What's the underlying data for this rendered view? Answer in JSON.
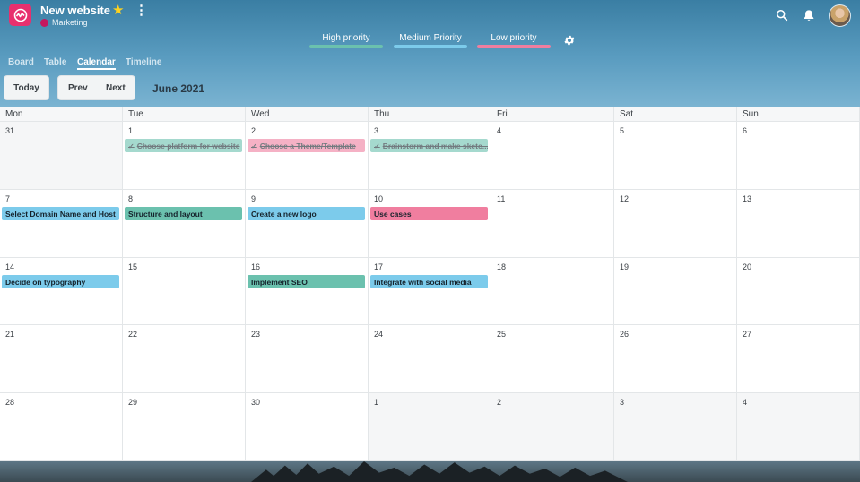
{
  "header": {
    "project_title": "New website",
    "team_name": "Marketing",
    "team_color": "#c4175e",
    "brand_color": "#e8306e",
    "icons": [
      "wave-logo-icon",
      "star-icon",
      "more-vertical-icon",
      "search-icon",
      "bell-icon",
      "gear-icon"
    ]
  },
  "legend": [
    {
      "label": "High priority",
      "color": "#6bc1ae"
    },
    {
      "label": "Medium Priority",
      "color": "#7ccbeb"
    },
    {
      "label": "Low priority",
      "color": "#f07e9f"
    }
  ],
  "views": [
    {
      "label": "Board",
      "active": false
    },
    {
      "label": "Table",
      "active": false
    },
    {
      "label": "Calendar",
      "active": true
    },
    {
      "label": "Timeline",
      "active": false
    }
  ],
  "toolbar": {
    "today_label": "Today",
    "prev_label": "Prev",
    "next_label": "Next",
    "month_label": "June 2021"
  },
  "calendar": {
    "weekdays": [
      "Mon",
      "Tue",
      "Wed",
      "Thu",
      "Fri",
      "Sat",
      "Sun"
    ],
    "weeks": [
      {
        "days": [
          {
            "n": "31",
            "muted": true
          },
          {
            "n": "1",
            "events": [
              {
                "title": "Choose platform for website",
                "priority": "high",
                "done": true
              }
            ]
          },
          {
            "n": "2",
            "events": [
              {
                "title": "Choose a Theme/Template",
                "priority": "low",
                "done": true
              }
            ]
          },
          {
            "n": "3",
            "events": [
              {
                "title": "Brainstorm and make sketc...",
                "priority": "high",
                "done": true
              }
            ]
          },
          {
            "n": "4"
          },
          {
            "n": "5"
          },
          {
            "n": "6"
          }
        ]
      },
      {
        "days": [
          {
            "n": "7",
            "events": [
              {
                "title": "Select Domain Name and Host",
                "priority": "medium"
              }
            ]
          },
          {
            "n": "8",
            "events": [
              {
                "title": "Structure and layout",
                "priority": "high"
              }
            ]
          },
          {
            "n": "9",
            "events": [
              {
                "title": "Create a new logo",
                "priority": "medium"
              }
            ]
          },
          {
            "n": "10",
            "events": [
              {
                "title": "Use cases",
                "priority": "low"
              }
            ]
          },
          {
            "n": "11"
          },
          {
            "n": "12"
          },
          {
            "n": "13"
          }
        ]
      },
      {
        "days": [
          {
            "n": "14",
            "events": [
              {
                "title": "Decide on typography",
                "priority": "medium"
              }
            ]
          },
          {
            "n": "15"
          },
          {
            "n": "16",
            "events": [
              {
                "title": "Implement SEO",
                "priority": "high"
              }
            ]
          },
          {
            "n": "17",
            "events": [
              {
                "title": "Integrate with social media",
                "priority": "medium"
              }
            ]
          },
          {
            "n": "18"
          },
          {
            "n": "19"
          },
          {
            "n": "20"
          }
        ]
      },
      {
        "days": [
          {
            "n": "21"
          },
          {
            "n": "22"
          },
          {
            "n": "23"
          },
          {
            "n": "24"
          },
          {
            "n": "25"
          },
          {
            "n": "26"
          },
          {
            "n": "27"
          }
        ]
      },
      {
        "days": [
          {
            "n": "28"
          },
          {
            "n": "29"
          },
          {
            "n": "30"
          },
          {
            "n": "1",
            "muted": true
          },
          {
            "n": "2",
            "muted": true
          },
          {
            "n": "3",
            "muted": true
          },
          {
            "n": "4",
            "muted": true
          }
        ]
      }
    ]
  }
}
